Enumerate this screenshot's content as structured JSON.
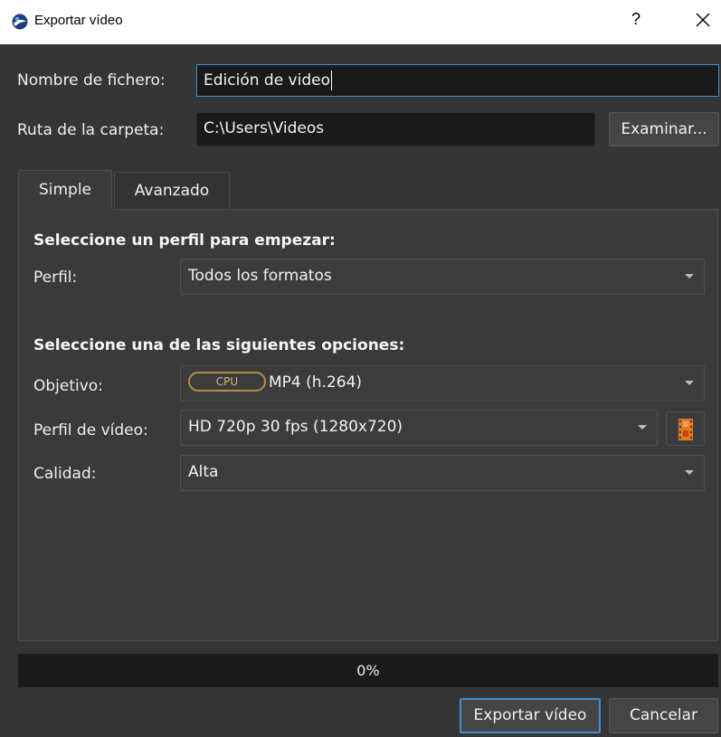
{
  "window": {
    "title": "Exportar vídeo",
    "help_label": "?",
    "close_label": "Cerrar"
  },
  "form": {
    "filename_label": "Nombre de fichero:",
    "filename_value": "Edición de video",
    "folder_label": "Ruta de la carpeta:",
    "folder_value": "C:\\Users\\Videos",
    "browse_label": "Examinar..."
  },
  "tabs": [
    {
      "label": "Simple",
      "active": true
    },
    {
      "label": "Avanzado",
      "active": false
    }
  ],
  "simple": {
    "profile_heading": "Seleccione un perfil para empezar:",
    "profile_label": "Perfil:",
    "profile_value": "Todos los formatos",
    "options_heading": "Seleccione una de las siguientes opciones:",
    "target_label": "Objetivo:",
    "target_badge": "CPU",
    "target_value": "MP4 (h.264)",
    "video_profile_label": "Perfil de vídeo:",
    "video_profile_value": "HD 720p 30 fps (1280x720)",
    "quality_label": "Calidad:",
    "quality_value": "Alta"
  },
  "progress": {
    "value": 0,
    "text": "0%"
  },
  "actions": {
    "export_label": "Exportar vídeo",
    "cancel_label": "Cancelar"
  },
  "colors": {
    "background": "#353535",
    "accent": "#3d8fd6",
    "badge": "#b28e49",
    "film_icon": "#e07a1f"
  }
}
